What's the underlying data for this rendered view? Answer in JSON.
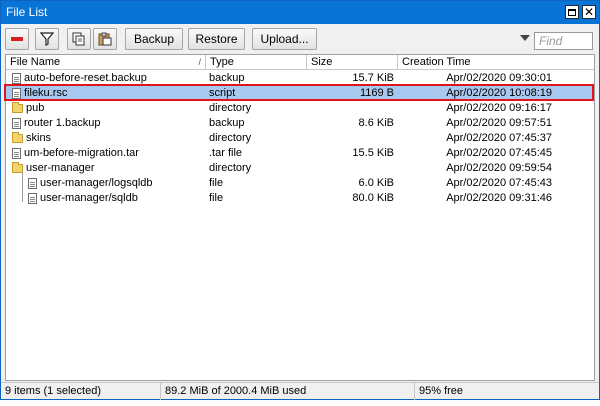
{
  "window": {
    "title": "File List"
  },
  "toolbar": {
    "backup_label": "Backup",
    "restore_label": "Restore",
    "upload_label": "Upload...",
    "find_placeholder": "Find"
  },
  "columns": {
    "name": "File Name",
    "type": "Type",
    "size": "Size",
    "date": "Creation Time",
    "sort_marker": "/"
  },
  "files": [
    {
      "name": "auto-before-reset.backup",
      "type": "backup",
      "size": "15.7 KiB",
      "date": "Apr/02/2020 09:30:01",
      "icon": "file-icon",
      "indent": 0,
      "selected": false
    },
    {
      "name": "fileku.rsc",
      "type": "script",
      "size": "1169 B",
      "date": "Apr/02/2020 10:08:19",
      "icon": "file-icon",
      "indent": 0,
      "selected": true
    },
    {
      "name": "pub",
      "type": "directory",
      "size": "",
      "date": "Apr/02/2020 09:16:17",
      "icon": "folder-icon",
      "indent": 0,
      "selected": false
    },
    {
      "name": "router 1.backup",
      "type": "backup",
      "size": "8.6 KiB",
      "date": "Apr/02/2020 09:57:51",
      "icon": "file-icon",
      "indent": 0,
      "selected": false
    },
    {
      "name": "skins",
      "type": "directory",
      "size": "",
      "date": "Apr/02/2020 07:45:37",
      "icon": "folder-icon",
      "indent": 0,
      "selected": false
    },
    {
      "name": "um-before-migration.tar",
      "type": ".tar file",
      "size": "15.5 KiB",
      "date": "Apr/02/2020 07:45:45",
      "icon": "file-icon",
      "indent": 0,
      "selected": false
    },
    {
      "name": "user-manager",
      "type": "directory",
      "size": "",
      "date": "Apr/02/2020 09:59:54",
      "icon": "folder-icon",
      "indent": 0,
      "selected": false
    },
    {
      "name": "user-manager/logsqldb",
      "type": "file",
      "size": "6.0 KiB",
      "date": "Apr/02/2020 07:45:43",
      "icon": "file-icon",
      "indent": 1,
      "selected": false
    },
    {
      "name": "user-manager/sqldb",
      "type": "file",
      "size": "80.0 KiB",
      "date": "Apr/02/2020 09:31:46",
      "icon": "file-icon",
      "indent": 1,
      "selected": false
    }
  ],
  "status": {
    "items": "9 items (1 selected)",
    "used": "89.2 MiB of 2000.4 MiB used",
    "free": "95% free"
  }
}
